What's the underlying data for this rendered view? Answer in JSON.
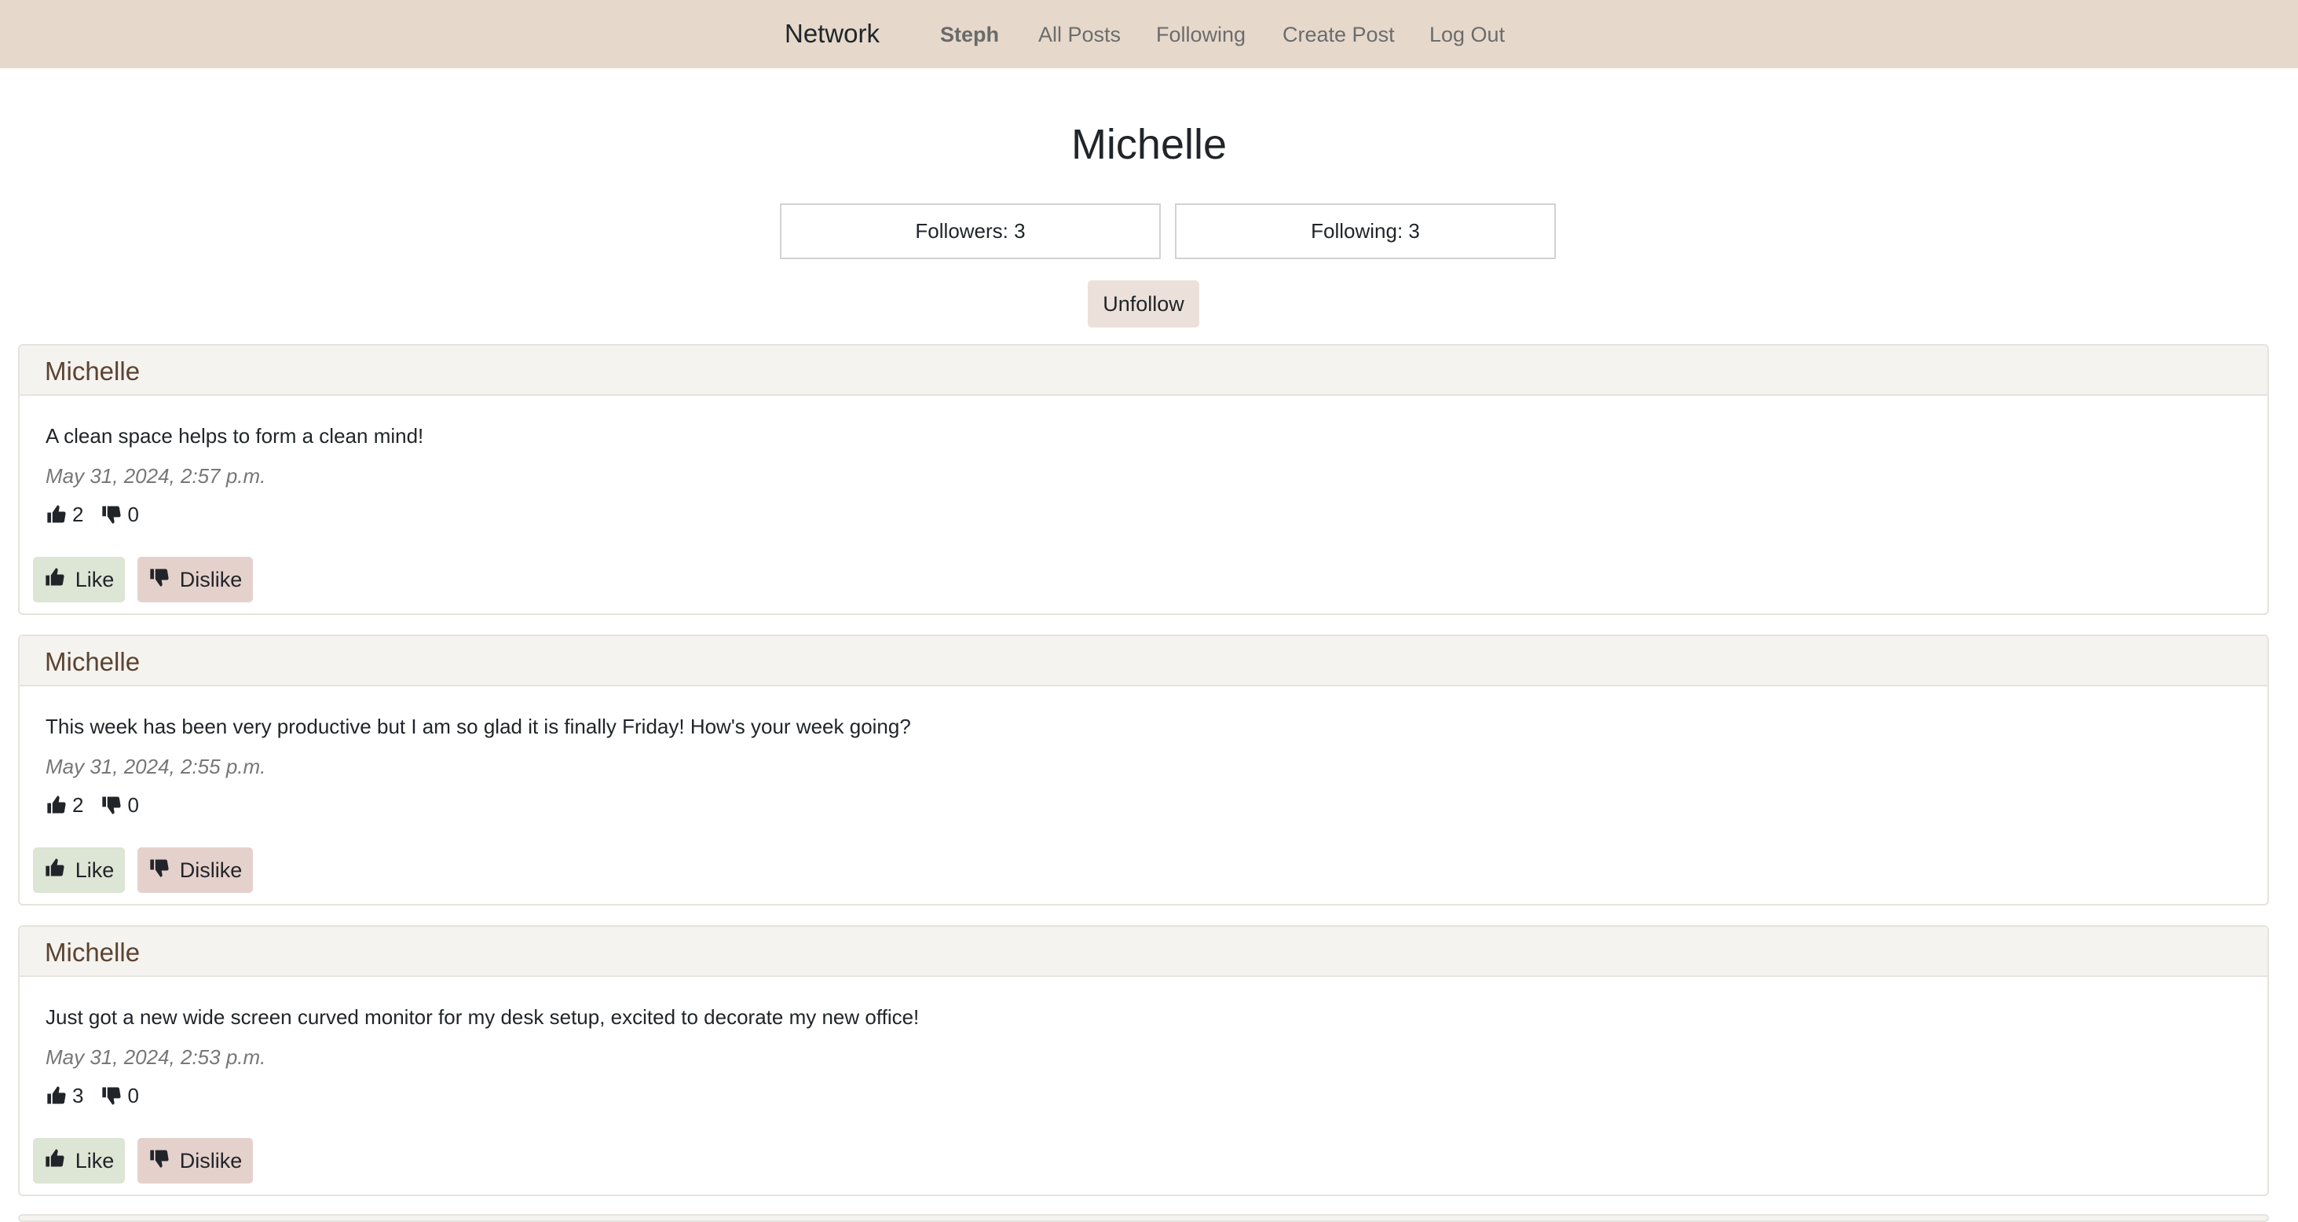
{
  "nav": {
    "brand": "Network",
    "user": "Steph",
    "all_posts": "All Posts",
    "following": "Following",
    "create_post": "Create Post",
    "log_out": "Log Out"
  },
  "profile": {
    "name": "Michelle",
    "followers": "Followers: 3",
    "following": "Following: 3",
    "follow_button": "Unfollow"
  },
  "posts": [
    {
      "author": "Michelle",
      "content": "A clean space helps to form a clean mind!",
      "timestamp": "May 31, 2024, 2:57 p.m.",
      "likes": "2",
      "dislikes": "0",
      "like_label": "Like",
      "dislike_label": "Dislike"
    },
    {
      "author": "Michelle",
      "content": "This week has been very productive but I am so glad it is finally Friday! How's your week going?",
      "timestamp": "May 31, 2024, 2:55 p.m.",
      "likes": "2",
      "dislikes": "0",
      "like_label": "Like",
      "dislike_label": "Dislike"
    },
    {
      "author": "Michelle",
      "content": "Just got a new wide screen curved monitor for my desk setup, excited to decorate my new office!",
      "timestamp": "May 31, 2024, 2:53 p.m.",
      "likes": "3",
      "dislikes": "0",
      "like_label": "Like",
      "dislike_label": "Dislike"
    }
  ],
  "icons": {
    "like": "thumbs-up-icon",
    "dislike": "thumbs-down-icon"
  },
  "colors": {
    "navbar_bg": "#e6d9cc",
    "author_text": "#5c4330",
    "like_button_bg": "#dde5d5",
    "dislike_button_bg": "#e5d1cc",
    "unfollow_button_bg": "#ebe1da"
  }
}
